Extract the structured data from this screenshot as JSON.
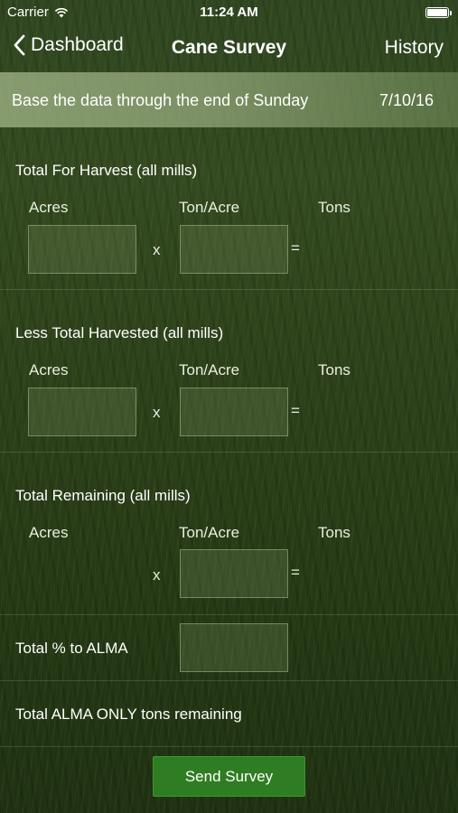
{
  "status_bar": {
    "carrier": "Carrier",
    "time": "11:24 AM",
    "icons": [
      "wifi-icon",
      "battery-icon"
    ]
  },
  "nav": {
    "back_label": "Dashboard",
    "title": "Cane Survey",
    "right_label": "History"
  },
  "banner": {
    "text": "Base the data through the end of Sunday",
    "date": "7/10/16"
  },
  "sections": {
    "total_for_harvest": {
      "title": "Total For Harvest (all mills)",
      "acres_label": "Acres",
      "ton_acre_label": "Ton/Acre",
      "tons_label": "Tons",
      "times": "x",
      "equals": "="
    },
    "less_total_harvested": {
      "title": "Less Total Harvested (all mills)",
      "acres_label": "Acres",
      "ton_acre_label": "Ton/Acre",
      "tons_label": "Tons",
      "times": "x",
      "equals": "="
    },
    "total_remaining": {
      "title": "Total Remaining (all mills)",
      "acres_label": "Acres",
      "ton_acre_label": "Ton/Acre",
      "tons_label": "Tons",
      "times": "x",
      "equals": "="
    },
    "total_pct_alma": {
      "title": "Total % to ALMA"
    },
    "alma_only": {
      "title": "Total ALMA ONLY tons remaining"
    }
  },
  "actions": {
    "send_label": "Send Survey"
  },
  "colors": {
    "background": "#2c4119",
    "button": "#2f7d22",
    "banner": "#96aa7d"
  }
}
